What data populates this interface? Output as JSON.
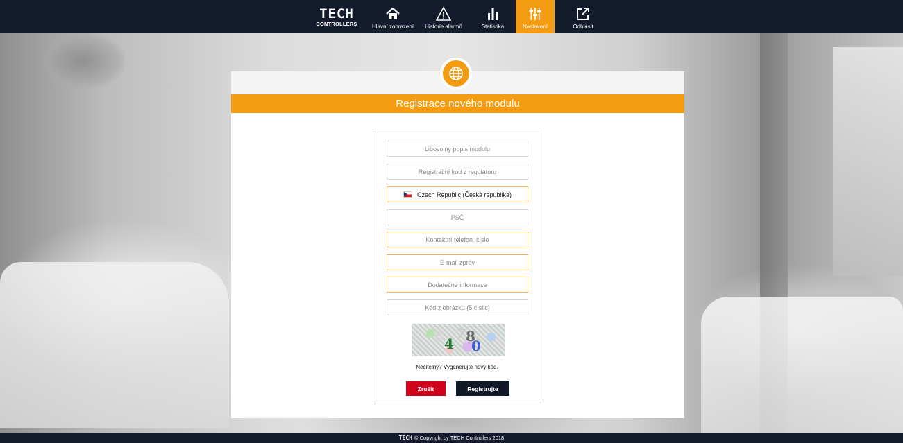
{
  "header": {
    "logo_main": "TECH",
    "logo_sub": "CONTROLLERS",
    "nav": [
      {
        "label": "Hlavní zobrazení",
        "icon": "home-icon"
      },
      {
        "label": "Historie alarmů",
        "icon": "warning-icon"
      },
      {
        "label": "Statistika",
        "icon": "stats-icon"
      },
      {
        "label": "Nastavení",
        "icon": "settings-sliders-icon",
        "active": true
      },
      {
        "label": "Odhlásit",
        "icon": "logout-icon"
      }
    ]
  },
  "card": {
    "badge_icon": "globe-icon",
    "title": "Registrace nového modulu"
  },
  "form": {
    "description_placeholder": "Libovolný popis modulu",
    "reg_code_placeholder": "Registrační kód z regulátoru",
    "country_value": "Czech Republic (Česká republika)",
    "country_flag": "czech-flag-icon",
    "zip_placeholder": "PSČ",
    "phone_placeholder": "Kontaktní telefon. číslo",
    "email_placeholder": "E-mail zpráv",
    "info_placeholder": "Dodatečné informace",
    "captcha_placeholder": "Kód z obrázku (5 číslic)",
    "captcha_digits": [
      "8",
      "4",
      "7",
      "8",
      "0"
    ],
    "regen_text": "Nečitelný? Vygenerujte nový kód.",
    "cancel_label": "Zrušit",
    "register_label": "Registrujte"
  },
  "footer": {
    "logo": "TECH",
    "text": "© Copyright by TECH Controllers 2018"
  },
  "colors": {
    "accent": "#f39c12",
    "navbar": "#141b2d",
    "cancel": "#d0021b",
    "register": "#111827"
  }
}
